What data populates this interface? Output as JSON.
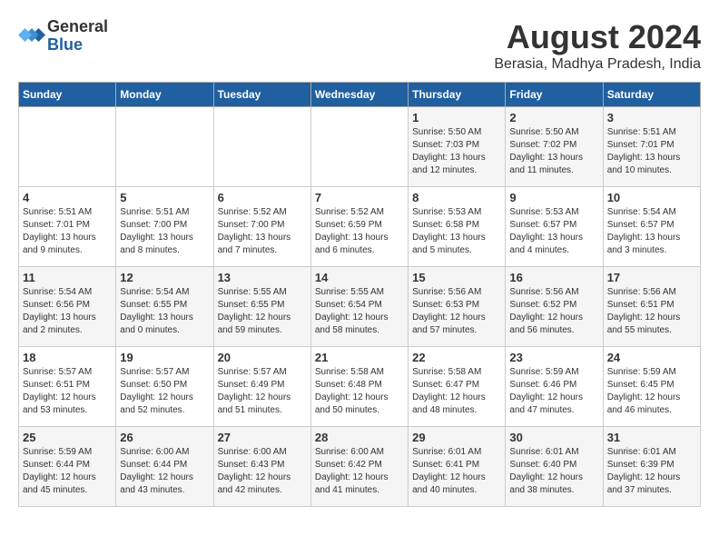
{
  "header": {
    "logo_line1": "General",
    "logo_line2": "Blue",
    "month_title": "August 2024",
    "location": "Berasia, Madhya Pradesh, India"
  },
  "weekdays": [
    "Sunday",
    "Monday",
    "Tuesday",
    "Wednesday",
    "Thursday",
    "Friday",
    "Saturday"
  ],
  "weeks": [
    [
      {
        "day": "",
        "info": ""
      },
      {
        "day": "",
        "info": ""
      },
      {
        "day": "",
        "info": ""
      },
      {
        "day": "",
        "info": ""
      },
      {
        "day": "1",
        "info": "Sunrise: 5:50 AM\nSunset: 7:03 PM\nDaylight: 13 hours\nand 12 minutes."
      },
      {
        "day": "2",
        "info": "Sunrise: 5:50 AM\nSunset: 7:02 PM\nDaylight: 13 hours\nand 11 minutes."
      },
      {
        "day": "3",
        "info": "Sunrise: 5:51 AM\nSunset: 7:01 PM\nDaylight: 13 hours\nand 10 minutes."
      }
    ],
    [
      {
        "day": "4",
        "info": "Sunrise: 5:51 AM\nSunset: 7:01 PM\nDaylight: 13 hours\nand 9 minutes."
      },
      {
        "day": "5",
        "info": "Sunrise: 5:51 AM\nSunset: 7:00 PM\nDaylight: 13 hours\nand 8 minutes."
      },
      {
        "day": "6",
        "info": "Sunrise: 5:52 AM\nSunset: 7:00 PM\nDaylight: 13 hours\nand 7 minutes."
      },
      {
        "day": "7",
        "info": "Sunrise: 5:52 AM\nSunset: 6:59 PM\nDaylight: 13 hours\nand 6 minutes."
      },
      {
        "day": "8",
        "info": "Sunrise: 5:53 AM\nSunset: 6:58 PM\nDaylight: 13 hours\nand 5 minutes."
      },
      {
        "day": "9",
        "info": "Sunrise: 5:53 AM\nSunset: 6:57 PM\nDaylight: 13 hours\nand 4 minutes."
      },
      {
        "day": "10",
        "info": "Sunrise: 5:54 AM\nSunset: 6:57 PM\nDaylight: 13 hours\nand 3 minutes."
      }
    ],
    [
      {
        "day": "11",
        "info": "Sunrise: 5:54 AM\nSunset: 6:56 PM\nDaylight: 13 hours\nand 2 minutes."
      },
      {
        "day": "12",
        "info": "Sunrise: 5:54 AM\nSunset: 6:55 PM\nDaylight: 13 hours\nand 0 minutes."
      },
      {
        "day": "13",
        "info": "Sunrise: 5:55 AM\nSunset: 6:55 PM\nDaylight: 12 hours\nand 59 minutes."
      },
      {
        "day": "14",
        "info": "Sunrise: 5:55 AM\nSunset: 6:54 PM\nDaylight: 12 hours\nand 58 minutes."
      },
      {
        "day": "15",
        "info": "Sunrise: 5:56 AM\nSunset: 6:53 PM\nDaylight: 12 hours\nand 57 minutes."
      },
      {
        "day": "16",
        "info": "Sunrise: 5:56 AM\nSunset: 6:52 PM\nDaylight: 12 hours\nand 56 minutes."
      },
      {
        "day": "17",
        "info": "Sunrise: 5:56 AM\nSunset: 6:51 PM\nDaylight: 12 hours\nand 55 minutes."
      }
    ],
    [
      {
        "day": "18",
        "info": "Sunrise: 5:57 AM\nSunset: 6:51 PM\nDaylight: 12 hours\nand 53 minutes."
      },
      {
        "day": "19",
        "info": "Sunrise: 5:57 AM\nSunset: 6:50 PM\nDaylight: 12 hours\nand 52 minutes."
      },
      {
        "day": "20",
        "info": "Sunrise: 5:57 AM\nSunset: 6:49 PM\nDaylight: 12 hours\nand 51 minutes."
      },
      {
        "day": "21",
        "info": "Sunrise: 5:58 AM\nSunset: 6:48 PM\nDaylight: 12 hours\nand 50 minutes."
      },
      {
        "day": "22",
        "info": "Sunrise: 5:58 AM\nSunset: 6:47 PM\nDaylight: 12 hours\nand 48 minutes."
      },
      {
        "day": "23",
        "info": "Sunrise: 5:59 AM\nSunset: 6:46 PM\nDaylight: 12 hours\nand 47 minutes."
      },
      {
        "day": "24",
        "info": "Sunrise: 5:59 AM\nSunset: 6:45 PM\nDaylight: 12 hours\nand 46 minutes."
      }
    ],
    [
      {
        "day": "25",
        "info": "Sunrise: 5:59 AM\nSunset: 6:44 PM\nDaylight: 12 hours\nand 45 minutes."
      },
      {
        "day": "26",
        "info": "Sunrise: 6:00 AM\nSunset: 6:44 PM\nDaylight: 12 hours\nand 43 minutes."
      },
      {
        "day": "27",
        "info": "Sunrise: 6:00 AM\nSunset: 6:43 PM\nDaylight: 12 hours\nand 42 minutes."
      },
      {
        "day": "28",
        "info": "Sunrise: 6:00 AM\nSunset: 6:42 PM\nDaylight: 12 hours\nand 41 minutes."
      },
      {
        "day": "29",
        "info": "Sunrise: 6:01 AM\nSunset: 6:41 PM\nDaylight: 12 hours\nand 40 minutes."
      },
      {
        "day": "30",
        "info": "Sunrise: 6:01 AM\nSunset: 6:40 PM\nDaylight: 12 hours\nand 38 minutes."
      },
      {
        "day": "31",
        "info": "Sunrise: 6:01 AM\nSunset: 6:39 PM\nDaylight: 12 hours\nand 37 minutes."
      }
    ]
  ]
}
